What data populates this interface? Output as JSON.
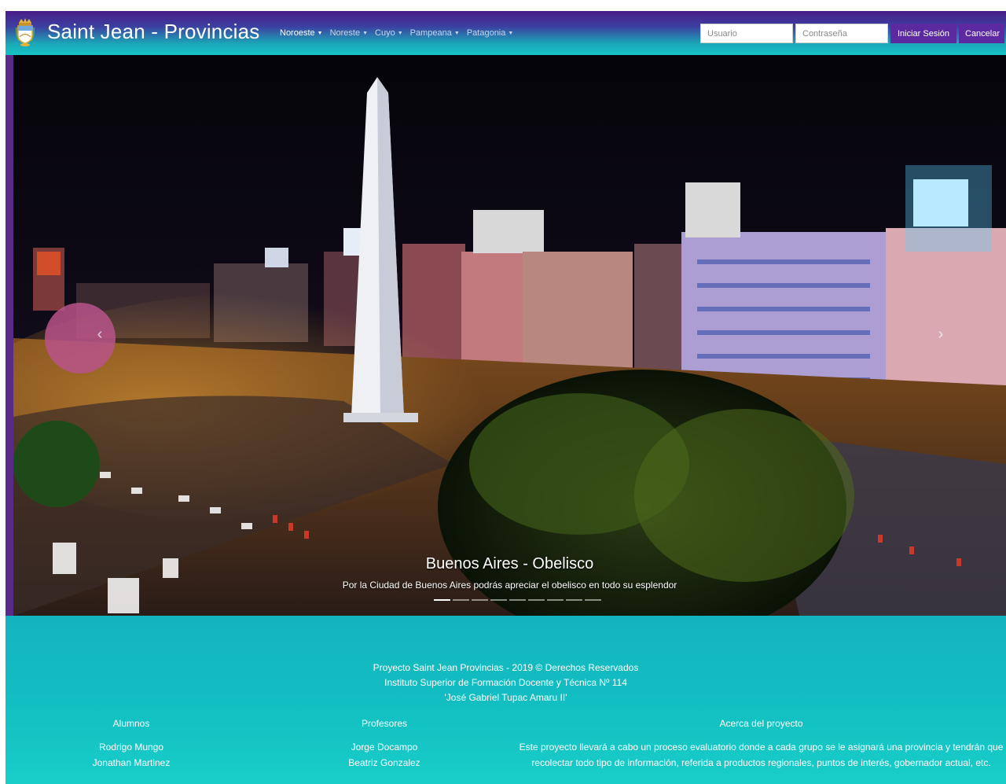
{
  "navbar": {
    "brand": "Saint Jean - Provincias",
    "menu": [
      {
        "label": "Noroeste",
        "active": true
      },
      {
        "label": "Noreste",
        "active": false
      },
      {
        "label": "Cuyo",
        "active": false
      },
      {
        "label": "Pampeana",
        "active": false
      },
      {
        "label": "Patagonia",
        "active": false
      }
    ],
    "username_placeholder": "Usuario",
    "password_placeholder": "Contraseña",
    "login_label": "Iniciar Sesión",
    "cancel_label": "Cancelar"
  },
  "carousel": {
    "title": "Buenos Aires - Obelisco",
    "text": "Por la Ciudad de Buenos Aires podrás apreciar el obelisco en todo su esplendor",
    "indicator_count": 9,
    "active_index": 0
  },
  "footer": {
    "line1": "Proyecto Saint Jean Provincias - 2019 © Derechos Reservados",
    "line2": "Instituto Superior de Formación Docente y Técnica Nº 114",
    "line3": "'José Gabriel Tupac Amaru II'",
    "alumnos_title": "Alumnos",
    "alumnos": [
      "Rodrigo Mungo",
      "Jonathan Martinez"
    ],
    "profesores_title": "Profesores",
    "profesores": [
      "Jorge Docampo",
      "Beatriz Gonzalez"
    ],
    "acerca_title": "Acerca del proyecto",
    "acerca_text": "Este proyecto llevará a cabo un proceso evaluatorio donde a cada grupo se le asignará una provincia y tendrán que recolectar todo tipo de información, referida a productos regionales, puntos de interés, gobernador actual, etc."
  },
  "colors": {
    "navbar_top": "#4b1c87",
    "navbar_bottom": "#14c2c4",
    "button_purple": "#5b2aa1",
    "footer": "#12bec2"
  },
  "icons": {
    "brand": "coat-of-arms-icon",
    "menu_caret": "caret-down-icon"
  }
}
